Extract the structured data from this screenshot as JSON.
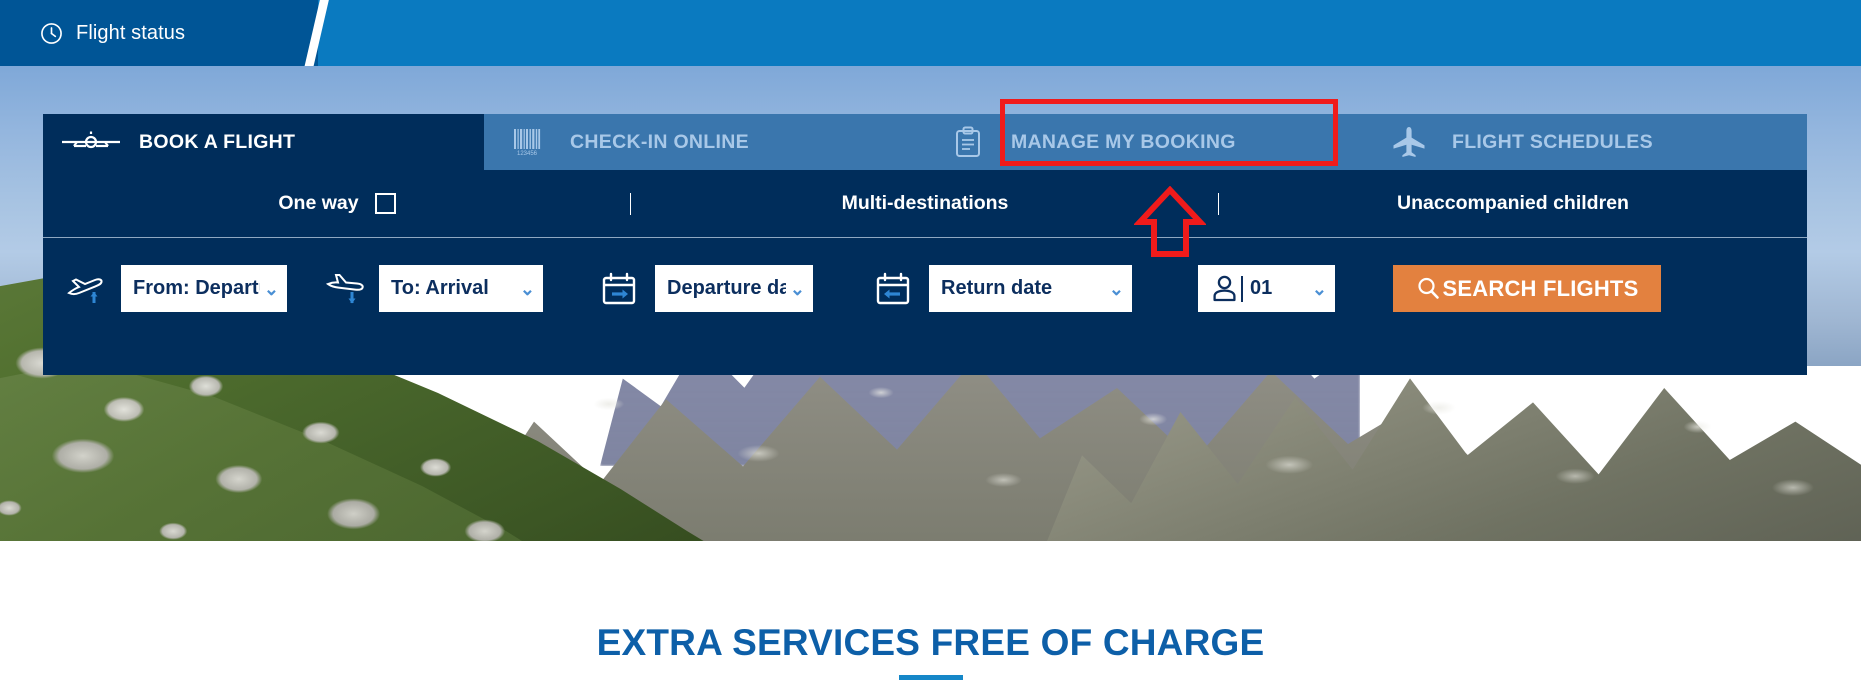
{
  "topbar": {
    "flight_status_label": "Flight status",
    "clock_icon": "clock-icon",
    "left_bg": "#005596",
    "right_bg": "#0a7ac0"
  },
  "booking_widget": {
    "tabs": [
      {
        "label": "BOOK A FLIGHT",
        "icon": "airplane-front-icon",
        "active": true
      },
      {
        "label": "CHECK-IN ONLINE",
        "icon": "barcode-icon",
        "active": false,
        "barcode_digits": "123456"
      },
      {
        "label": "MANAGE MY BOOKING",
        "icon": "clipboard-icon",
        "active": false
      },
      {
        "label": "FLIGHT SCHEDULES",
        "icon": "airplane-icon",
        "active": false
      }
    ],
    "options": [
      {
        "label": "One way",
        "has_checkbox": true,
        "checked": false
      },
      {
        "label": "Multi-destinations",
        "has_checkbox": false
      },
      {
        "label": "Unaccompanied children",
        "has_checkbox": false
      }
    ],
    "fields": {
      "from": {
        "icon": "plane-takeoff-icon",
        "value": "From: Departure",
        "caret": "ˇ"
      },
      "to": {
        "icon": "plane-landing-icon",
        "value": "To:   Arrival",
        "caret": "ˇ"
      },
      "departure_date": {
        "icon": "calendar-depart-icon",
        "value": "Departure date",
        "caret": "ˇ"
      },
      "return_date": {
        "icon": "calendar-return-icon",
        "value": "Return date",
        "caret": "ˇ"
      },
      "passengers": {
        "icon": "person-icon",
        "value": "01",
        "caret": "ˇ"
      }
    },
    "search_button": {
      "label": "SEARCH FLIGHTS",
      "icon": "magnifier-icon",
      "color": "#e3813f"
    },
    "panel_color": "#002d5b",
    "inactive_tab_color": "#3a76ad"
  },
  "annotations": {
    "highlight_box": {
      "target": "MANAGE MY BOOKING",
      "color": "#f01b1b"
    },
    "arrow": {
      "direction": "up",
      "color": "#f01b1b"
    }
  },
  "bottom_section": {
    "title": "EXTRA SERVICES FREE OF CHARGE",
    "title_color": "#0d5fa8",
    "underline_color": "#1587c8"
  }
}
